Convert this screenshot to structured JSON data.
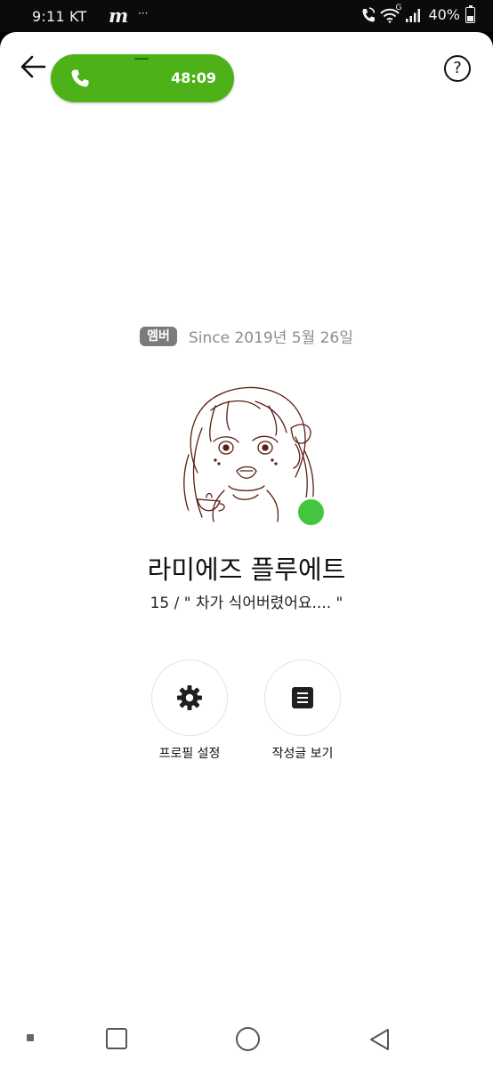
{
  "status_bar": {
    "time": "9:11 KT",
    "app_glyph": "m",
    "more": "···",
    "network": "G",
    "battery": "40%",
    "battery_level": 0.4,
    "icons": [
      "call-active-icon",
      "wifi-icon",
      "signal-icon",
      "battery-icon"
    ]
  },
  "header": {
    "back_icon": "arrow-left-icon",
    "call_timer": "48:09",
    "call_icon": "phone-icon",
    "help_label": "?"
  },
  "profile": {
    "badge": "멤버",
    "since": "Since 2019년 5월 26일",
    "name": "라미에즈 플루에트",
    "status_message": "15 /  \" 차가 식어버렸어요.... \"",
    "online": true,
    "online_color": "#43c63d"
  },
  "actions": [
    {
      "label": "프로필 설정",
      "icon": "gear-icon"
    },
    {
      "label": "작성글 보기",
      "icon": "document-list-icon"
    }
  ],
  "navbar": {
    "icons": [
      "menu-dot-icon",
      "recent-apps-icon",
      "home-icon",
      "back-icon"
    ]
  },
  "colors": {
    "accent": "#4cb218",
    "badge": "#7b7b7b",
    "status_bar": "#0b0b0b"
  }
}
